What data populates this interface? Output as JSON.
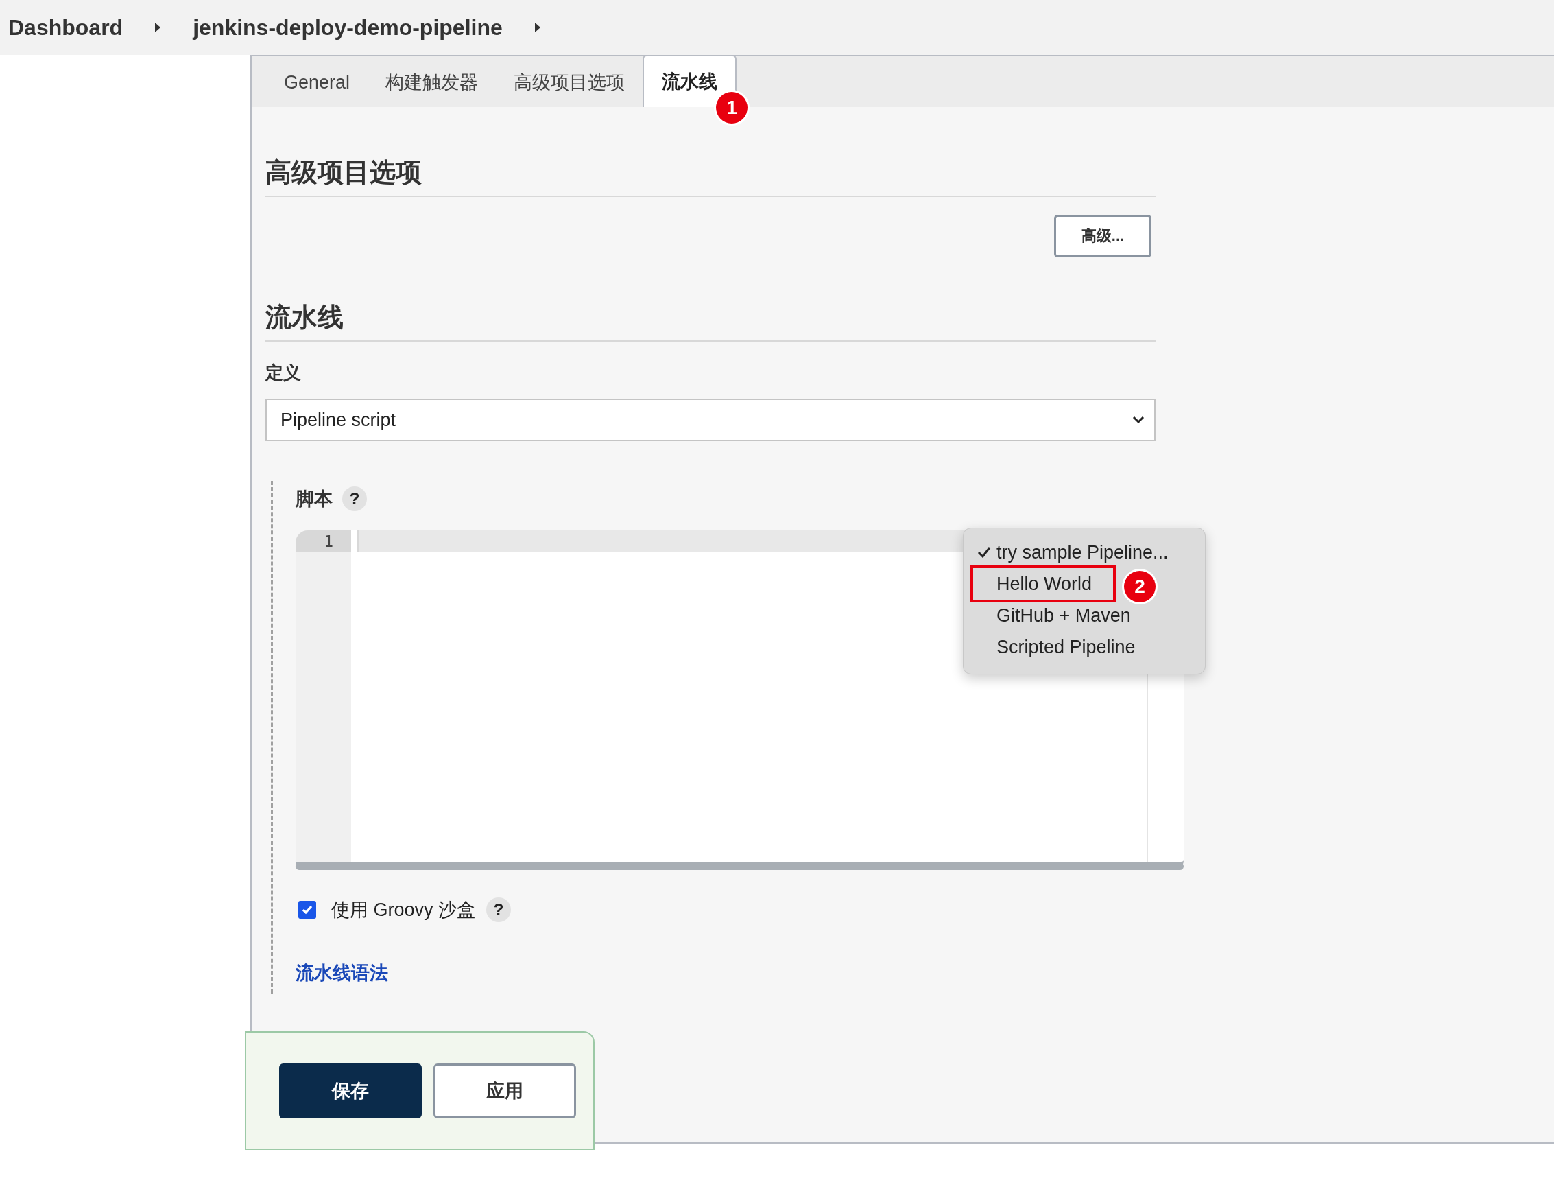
{
  "breadcrumbs": [
    {
      "label": "Dashboard"
    },
    {
      "label": "jenkins-deploy-demo-pipeline"
    }
  ],
  "tabs": [
    {
      "label": "General",
      "selected": false
    },
    {
      "label": "构建触发器",
      "selected": false
    },
    {
      "label": "高级项目选项",
      "selected": false
    },
    {
      "label": "流水线",
      "selected": true
    }
  ],
  "annotations": [
    {
      "label": "1"
    },
    {
      "label": "2"
    }
  ],
  "advanced_section": {
    "title": "高级项目选项",
    "button": "高级..."
  },
  "pipeline_section": {
    "title": "流水线",
    "definition_label": "定义",
    "definition_value": "Pipeline script",
    "script_label": "脚本",
    "script_help": "?",
    "line_numbers": [
      "1"
    ],
    "sandbox": {
      "label": "使用 Groovy 沙盒",
      "checked": true,
      "help": "?"
    },
    "syntax_link": "流水线语法"
  },
  "sample_menu": {
    "items": [
      {
        "label": "try sample Pipeline...",
        "selected": true,
        "highlighted": false
      },
      {
        "label": "Hello World",
        "selected": false,
        "highlighted": true
      },
      {
        "label": "GitHub + Maven",
        "selected": false,
        "highlighted": false
      },
      {
        "label": "Scripted Pipeline",
        "selected": false,
        "highlighted": false
      }
    ]
  },
  "buttons": [
    {
      "label": "保存",
      "kind": "primary"
    },
    {
      "label": "应用",
      "kind": "secondary"
    }
  ]
}
